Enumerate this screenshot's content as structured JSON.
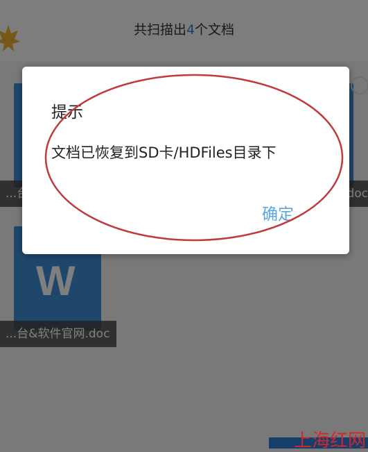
{
  "header": {
    "title_prefix": "共扫描出",
    "count": "4",
    "title_suffix": "个文档"
  },
  "files": [
    {
      "name": "...台",
      "ext": "...doc",
      "icon": "word-doc-icon"
    },
    {
      "name": "...台&软件官网.doc",
      "icon_letter": "W",
      "icon": "word-doc-icon"
    }
  ],
  "dialog": {
    "title": "提示",
    "message": "文档已恢复到SD卡/HDFiles目录下",
    "ok_label": "确定"
  },
  "watermark": "上海红网",
  "colors": {
    "accent": "#2f7fd9",
    "ok_text": "#59a7e0",
    "annotation": "#c0393b",
    "watermark": "#d0282a"
  }
}
